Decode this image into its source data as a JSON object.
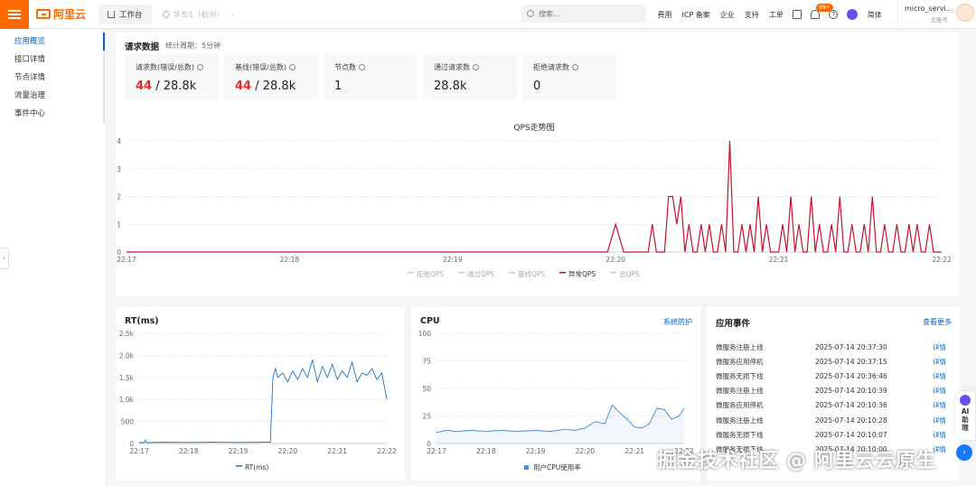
{
  "header": {
    "logo_text": "阿里云",
    "workbench": "工作台",
    "region": "华东1（杭州）",
    "search_placeholder": "搜索...",
    "nav": [
      "费用",
      "ICP 备案",
      "企业",
      "支持",
      "工单"
    ],
    "badge": "99+",
    "lang": "简体",
    "user_name": "micro_servi...",
    "user_role": "主账号"
  },
  "sidebar": {
    "items": [
      {
        "label": "应用概览",
        "active": true
      },
      {
        "label": "接口详情",
        "active": false
      },
      {
        "label": "节点详情",
        "active": false
      },
      {
        "label": "流量治理",
        "active": false
      },
      {
        "label": "事件中心",
        "active": false
      }
    ]
  },
  "request": {
    "title": "请求数据",
    "period": "统计周期：5分钟",
    "stats": [
      {
        "label": "请求数(错误/总数)",
        "err": "44",
        "total": "/ 28.8k"
      },
      {
        "label": "基线(错误/总数)",
        "err": "44",
        "total": "/ 28.8k"
      },
      {
        "label": "节点数",
        "err": "",
        "total": "1"
      },
      {
        "label": "通过请求数",
        "err": "",
        "total": "28.8k"
      },
      {
        "label": "拒绝请求数",
        "err": "",
        "total": "0"
      }
    ]
  },
  "panels": {
    "rt_title": "RT(ms)",
    "cpu_title": "CPU",
    "cpu_link": "系统防护",
    "events_title": "应用事件",
    "events_link": "查看更多"
  },
  "events": [
    {
      "name": "微服务注册上线",
      "time": "2025-07-14 20:37:30",
      "link": "详情"
    },
    {
      "name": "微服务应用停机",
      "time": "2025-07-14 20:37:15",
      "link": "详情"
    },
    {
      "name": "微服务无损下线",
      "time": "2025-07-14 20:36:46",
      "link": "详情"
    },
    {
      "name": "微服务注册上线",
      "time": "2025-07-14 20:10:39",
      "link": "详情"
    },
    {
      "name": "微服务应用停机",
      "time": "2025-07-14 20:10:36",
      "link": "详情"
    },
    {
      "name": "微服务注册上线",
      "time": "2025-07-14 20:10:28",
      "link": "详情"
    },
    {
      "name": "微服务无损下线",
      "time": "2025-07-14 20:10:07",
      "link": "详情"
    },
    {
      "name": "微服务无损下线",
      "time": "2025-07-14 20:10:00",
      "link": "详情"
    }
  ],
  "ai_assistant": "AI助理",
  "watermark": "掘金技术社区 @ 阿里云云原生",
  "colors": {
    "accent": "#ff6a00",
    "link": "#0064c8",
    "error": "#e22b2b",
    "qps_line": "#c8102e",
    "rt_line": "#1677c8",
    "cpu_line": "#4a90e2"
  },
  "chart_data": [
    {
      "type": "line",
      "title": "QPS走势图",
      "x_ticks": [
        "22:17",
        "22:18",
        "22:19",
        "22:20",
        "22:21",
        "22:22"
      ],
      "ylim": [
        0,
        4
      ],
      "y_ticks": [
        "0",
        "1",
        "2",
        "3",
        "4"
      ],
      "grid": true,
      "legend": [
        "拒绝QPS",
        "通过QPS",
        "基线QPS",
        "异常QPS",
        "总QPS"
      ],
      "legend_placement": "bottom",
      "series": [
        {
          "name": "异常QPS",
          "x": [
            0,
            0.59,
            0.6,
            0.61,
            0.64,
            0.645,
            0.65,
            0.66,
            0.665,
            0.67,
            0.675,
            0.68,
            0.685,
            0.69,
            0.695,
            0.7,
            0.705,
            0.71,
            0.715,
            0.72,
            0.725,
            0.73,
            0.735,
            0.74,
            0.745,
            0.75,
            0.755,
            0.76,
            0.765,
            0.77,
            0.775,
            0.78,
            0.785,
            0.79,
            0.8,
            0.805,
            0.81,
            0.815,
            0.82,
            0.825,
            0.83,
            0.835,
            0.84,
            0.845,
            0.85,
            0.855,
            0.86,
            0.865,
            0.87,
            0.875,
            0.88,
            0.885,
            0.89,
            0.895,
            0.9,
            0.905,
            0.91,
            0.915,
            0.92,
            0.925,
            0.93,
            0.935,
            0.94,
            0.945,
            0.95,
            0.955,
            0.96,
            0.965,
            0.97,
            0.975,
            0.98,
            0.985,
            0.99,
            1
          ],
          "values": [
            0,
            0,
            1,
            0,
            0,
            1,
            0,
            0,
            2,
            2,
            1,
            2,
            0,
            1,
            0,
            0,
            1,
            0,
            1,
            0,
            0,
            1,
            0,
            4,
            0,
            0,
            1,
            0,
            1,
            0,
            2,
            0,
            1,
            0,
            0,
            1,
            0,
            2,
            0,
            1,
            0,
            0,
            2,
            0,
            1,
            0,
            0,
            1,
            0,
            2,
            0,
            0,
            1,
            0,
            0,
            1,
            0,
            2,
            0,
            0,
            1,
            0,
            0,
            1,
            0,
            0,
            1,
            0,
            1,
            0,
            0,
            1,
            0,
            0
          ]
        }
      ]
    },
    {
      "type": "line",
      "title": "RT(ms)",
      "x_ticks": [
        "22:17",
        "22:18",
        "22:19",
        "22:20",
        "22:21",
        "22:22"
      ],
      "ylim": [
        0,
        2500
      ],
      "y_ticks": [
        "0",
        "500",
        "1.0k",
        "1.5k",
        "2.0k",
        "2.5k"
      ],
      "legend": [
        "RT(ms)"
      ],
      "series": [
        {
          "name": "RT(ms)",
          "x": [
            0,
            0.02,
            0.025,
            0.03,
            0.1,
            0.2,
            0.3,
            0.4,
            0.5,
            0.53,
            0.54,
            0.55,
            0.56,
            0.58,
            0.6,
            0.62,
            0.64,
            0.66,
            0.68,
            0.7,
            0.72,
            0.74,
            0.76,
            0.78,
            0.8,
            0.82,
            0.84,
            0.86,
            0.88,
            0.9,
            0.92,
            0.94,
            0.96,
            0.98,
            1
          ],
          "values": [
            20,
            20,
            80,
            20,
            30,
            25,
            30,
            25,
            30,
            30,
            1500,
            1700,
            1500,
            1600,
            1400,
            1650,
            1450,
            1700,
            1500,
            1900,
            1400,
            1750,
            1500,
            1800,
            1450,
            1650,
            1500,
            1850,
            1400,
            1600,
            1550,
            1700,
            1450,
            1600,
            1000
          ]
        }
      ]
    },
    {
      "type": "area",
      "title": "CPU",
      "x_ticks": [
        "22:17",
        "22:18",
        "22:19",
        "22:20",
        "22:21",
        "22:22"
      ],
      "ylim": [
        0,
        100
      ],
      "y_ticks": [
        "0",
        "25",
        "50",
        "75",
        "100"
      ],
      "legend": [
        "用户CPU使用率"
      ],
      "series": [
        {
          "name": "用户CPU使用率",
          "x": [
            0,
            0.04,
            0.08,
            0.14,
            0.2,
            0.26,
            0.32,
            0.4,
            0.46,
            0.52,
            0.56,
            0.6,
            0.64,
            0.68,
            0.71,
            0.74,
            0.77,
            0.8,
            0.83,
            0.86,
            0.89,
            0.92,
            0.95,
            0.98,
            1
          ],
          "values": [
            10,
            12,
            11,
            12,
            11,
            12,
            11,
            12,
            11,
            13,
            12,
            14,
            20,
            18,
            35,
            28,
            22,
            15,
            14,
            18,
            32,
            31,
            22,
            25,
            32
          ]
        }
      ]
    }
  ]
}
